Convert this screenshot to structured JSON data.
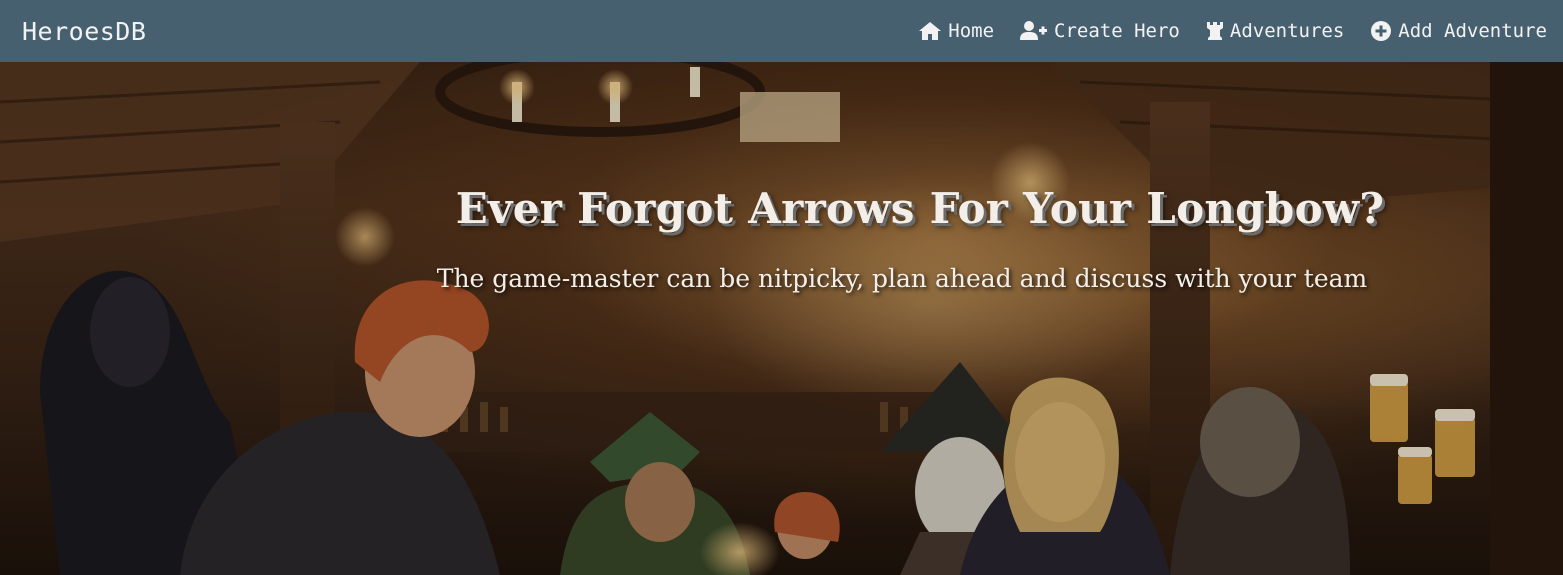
{
  "navbar": {
    "brand": "HeroesDB",
    "links": [
      {
        "label": "Home",
        "icon": "home-icon"
      },
      {
        "label": "Create Hero",
        "icon": "user-plus-icon"
      },
      {
        "label": "Adventures",
        "icon": "tower-icon"
      },
      {
        "label": "Add Adventure",
        "icon": "plus-circle-icon"
      }
    ]
  },
  "hero": {
    "title": "Ever Forgot Arrows For Your Longbow?",
    "subtitle": "The game-master can be nitpicky, plan ahead and discuss with your team",
    "image": "tavern-illustration"
  },
  "colors": {
    "navbar_bg": "#47606f",
    "text": "#f2f2f2"
  }
}
